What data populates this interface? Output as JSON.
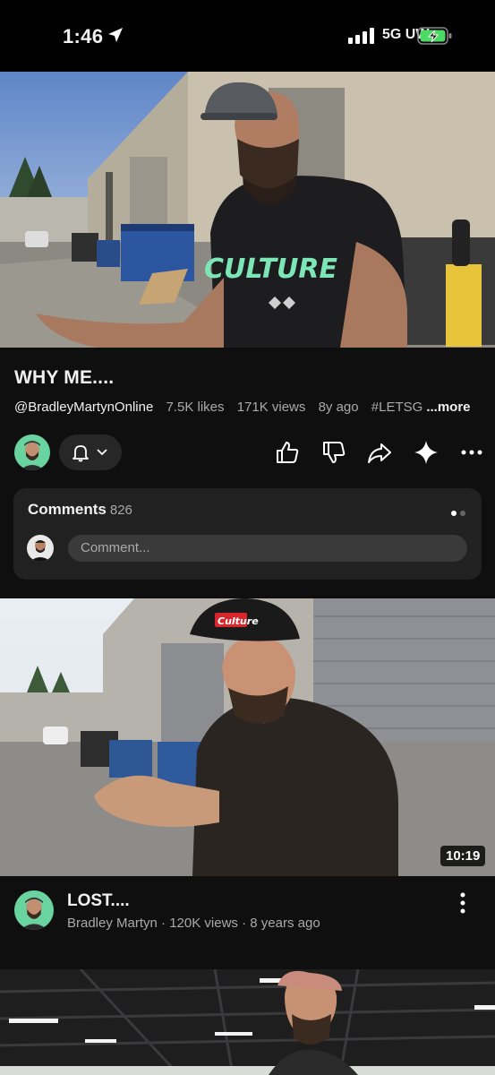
{
  "status_bar": {
    "time": "1:46",
    "network": "5G UW"
  },
  "current_video": {
    "title": "WHY ME....",
    "channel": "@BradleyMartynOnline",
    "likes": "7.5K likes",
    "views": "171K views",
    "age": "8y ago",
    "hashtag": "#LETSG",
    "more_label": "...more",
    "shirt_text": "CULTURE"
  },
  "comments": {
    "title": "Comments",
    "count": "826",
    "placeholder": "Comment..."
  },
  "feed": [
    {
      "title": "LOST....",
      "channel": "Bradley Martyn",
      "views": "120K views",
      "age": "8 years ago",
      "duration": "10:19",
      "hat_text": "Culture"
    }
  ],
  "colors": {
    "background": "#0f0f0f",
    "card": "#212121",
    "accent_green": "#6ad4a0",
    "secondary_text": "#aaaaaa"
  },
  "icons": [
    "location-arrow-icon",
    "signal-icon",
    "battery-charging-icon",
    "bell-icon",
    "chevron-down-icon",
    "like-icon",
    "dislike-icon",
    "share-icon",
    "sparkle-icon",
    "more-horizontal-icon",
    "more-vertical-icon"
  ]
}
